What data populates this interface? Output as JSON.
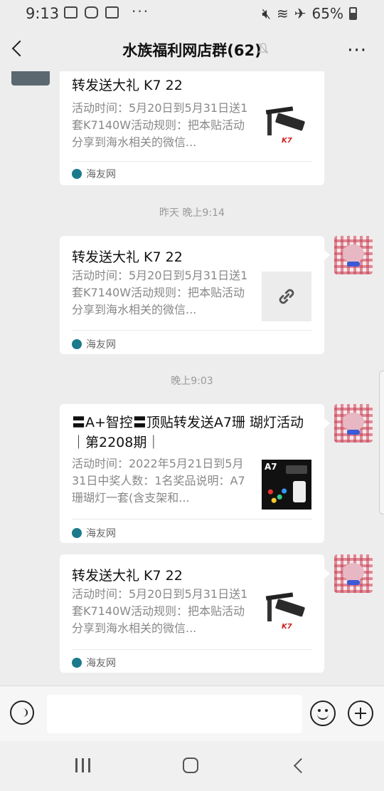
{
  "status_bar": {
    "time": "9:13",
    "battery": "65%",
    "more": "···"
  },
  "header": {
    "title": "水族福利网店群(62)",
    "more": "···"
  },
  "messages": [
    {
      "title": "转发送大礼 K7 22",
      "desc": "活动时间：5月20日到5月31日送1套K7140W活动规则：把本贴活动分享到海水相关的微信...",
      "source": "海友网",
      "thumb_icon": "lamp-image",
      "thumb_logo": "K7"
    },
    {
      "title": "转发送大礼 K7 22",
      "desc": "活动时间：5月20日到5月31日送1套K7140W活动规则：把本贴活动分享到海水相关的微信...",
      "source": "海友网",
      "thumb_icon": "link-icon"
    },
    {
      "title": "〓A+智控〓顶贴转发送A7珊 瑚灯活动｜第2208期｜",
      "desc": "活动时间：2022年5月21日到5月31日中奖人数：1名奖品说明：A7珊瑚灯一套(含支架和...",
      "source": "海友网",
      "thumb_icon": "a7-image",
      "thumb_label": "A7"
    },
    {
      "title": "转发送大礼 K7 22",
      "desc": "活动时间：5月20日到5月31日送1套K7140W活动规则：把本贴活动分享到海水相关的微信...",
      "source": "海友网",
      "thumb_icon": "lamp-image",
      "thumb_logo": "K7"
    }
  ],
  "timestamps": [
    "昨天 晚上9:14",
    "晚上9:03"
  ],
  "colors": {
    "background": "#ededed",
    "card": "#ffffff",
    "secondary_text": "#888888"
  }
}
